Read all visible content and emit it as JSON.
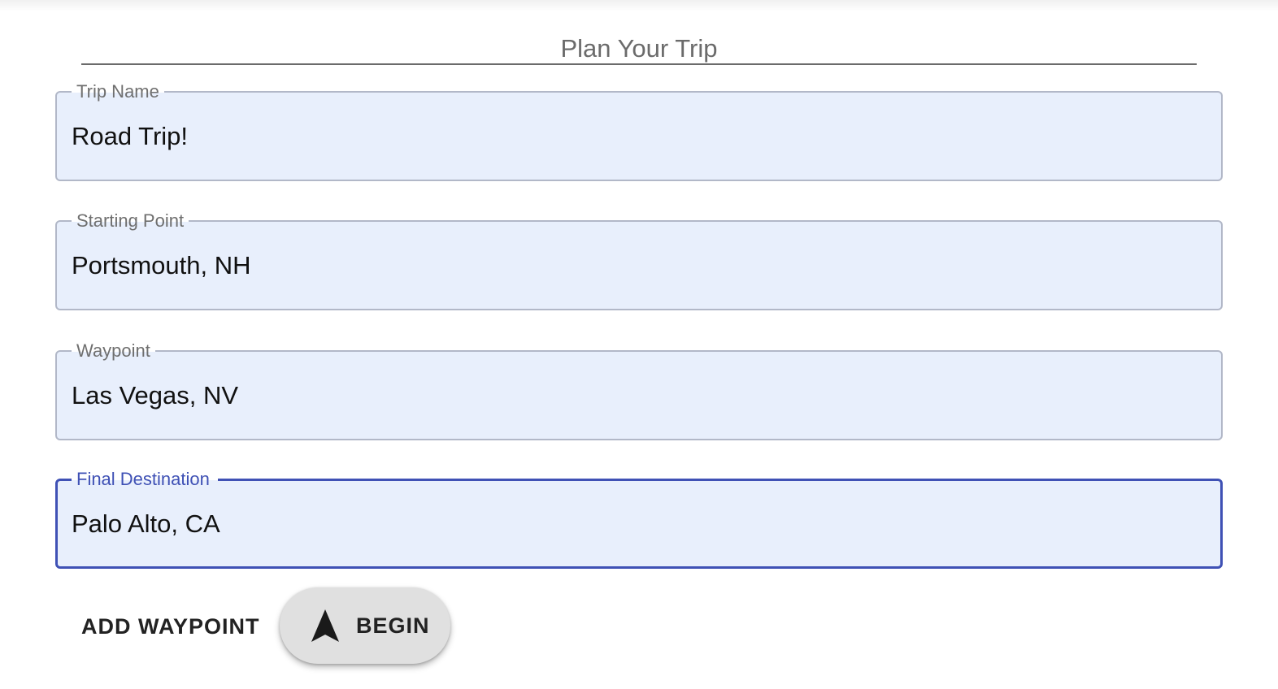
{
  "header": {
    "title": "Plan Your Trip"
  },
  "fields": [
    {
      "label": "Trip Name",
      "value": "Road Trip!"
    },
    {
      "label": "Starting Point",
      "value": "Portsmouth, NH"
    },
    {
      "label": "Waypoint",
      "value": "Las Vegas, NV"
    },
    {
      "label": "Final Destination",
      "value": "Palo Alto, CA"
    }
  ],
  "actions": {
    "add_waypoint_label": "ADD WAYPOINT",
    "begin_label": "BEGIN",
    "begin_icon": "navigation-arrow-icon"
  },
  "colors": {
    "accent": "#3f51b5",
    "field_background": "#e8effc",
    "fab_background": "#e0e0e0"
  }
}
